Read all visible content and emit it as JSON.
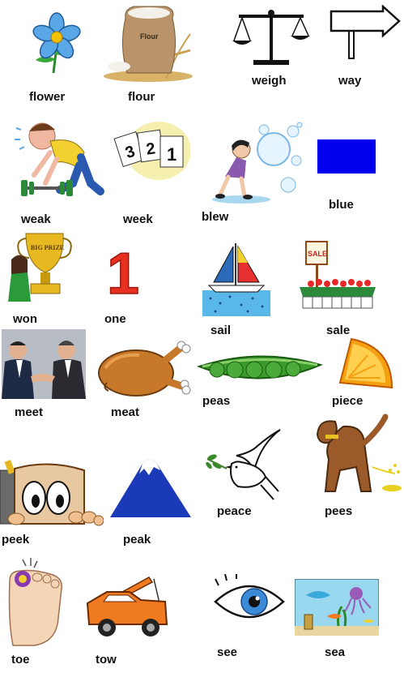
{
  "colors": {
    "blue_swatch": "#0000ee",
    "label_text": "#111111"
  },
  "words": [
    {
      "id": "flower",
      "label": "flower",
      "icon": "flower-icon"
    },
    {
      "id": "flour",
      "label": "flour",
      "icon": "flour-sack-icon",
      "sack_text": "Flour"
    },
    {
      "id": "weigh",
      "label": "weigh",
      "icon": "balance-scale-icon"
    },
    {
      "id": "way",
      "label": "way",
      "icon": "direction-sign-icon"
    },
    {
      "id": "weak",
      "label": "weak",
      "icon": "weightlifter-icon"
    },
    {
      "id": "week",
      "label": "week",
      "icon": "calendar-pages-icon",
      "digits": [
        "3",
        "2",
        "1"
      ]
    },
    {
      "id": "blew",
      "label": "blew",
      "icon": "bubble-blowing-icon"
    },
    {
      "id": "blue",
      "label": "blue",
      "icon": "blue-square-icon"
    },
    {
      "id": "won",
      "label": "won",
      "icon": "trophy-icon",
      "trophy_text": "BIG PRIZE"
    },
    {
      "id": "one",
      "label": "one",
      "icon": "number-one-icon",
      "digit": "1"
    },
    {
      "id": "sail",
      "label": "sail",
      "icon": "sailboat-icon"
    },
    {
      "id": "sale",
      "label": "sale",
      "icon": "market-stall-icon",
      "sign_text": "SALE"
    },
    {
      "id": "meet",
      "label": "meet",
      "icon": "handshake-icon"
    },
    {
      "id": "meat",
      "label": "meat",
      "icon": "roast-chicken-icon"
    },
    {
      "id": "peas",
      "label": "peas",
      "icon": "pea-pod-icon"
    },
    {
      "id": "piece",
      "label": "piece",
      "icon": "orange-slice-icon"
    },
    {
      "id": "peace",
      "label": "peace",
      "icon": "dove-icon"
    },
    {
      "id": "pees",
      "label": "pees",
      "icon": "dog-icon"
    },
    {
      "id": "peek",
      "label": "peek",
      "icon": "peeking-eyes-icon"
    },
    {
      "id": "peak",
      "label": "peak",
      "icon": "mountain-peak-icon"
    },
    {
      "id": "toe",
      "label": "toe",
      "icon": "hurt-toe-icon"
    },
    {
      "id": "tow",
      "label": "tow",
      "icon": "tow-truck-icon"
    },
    {
      "id": "see",
      "label": "see",
      "icon": "eye-icon"
    },
    {
      "id": "sea",
      "label": "sea",
      "icon": "sea-aquarium-icon"
    }
  ]
}
